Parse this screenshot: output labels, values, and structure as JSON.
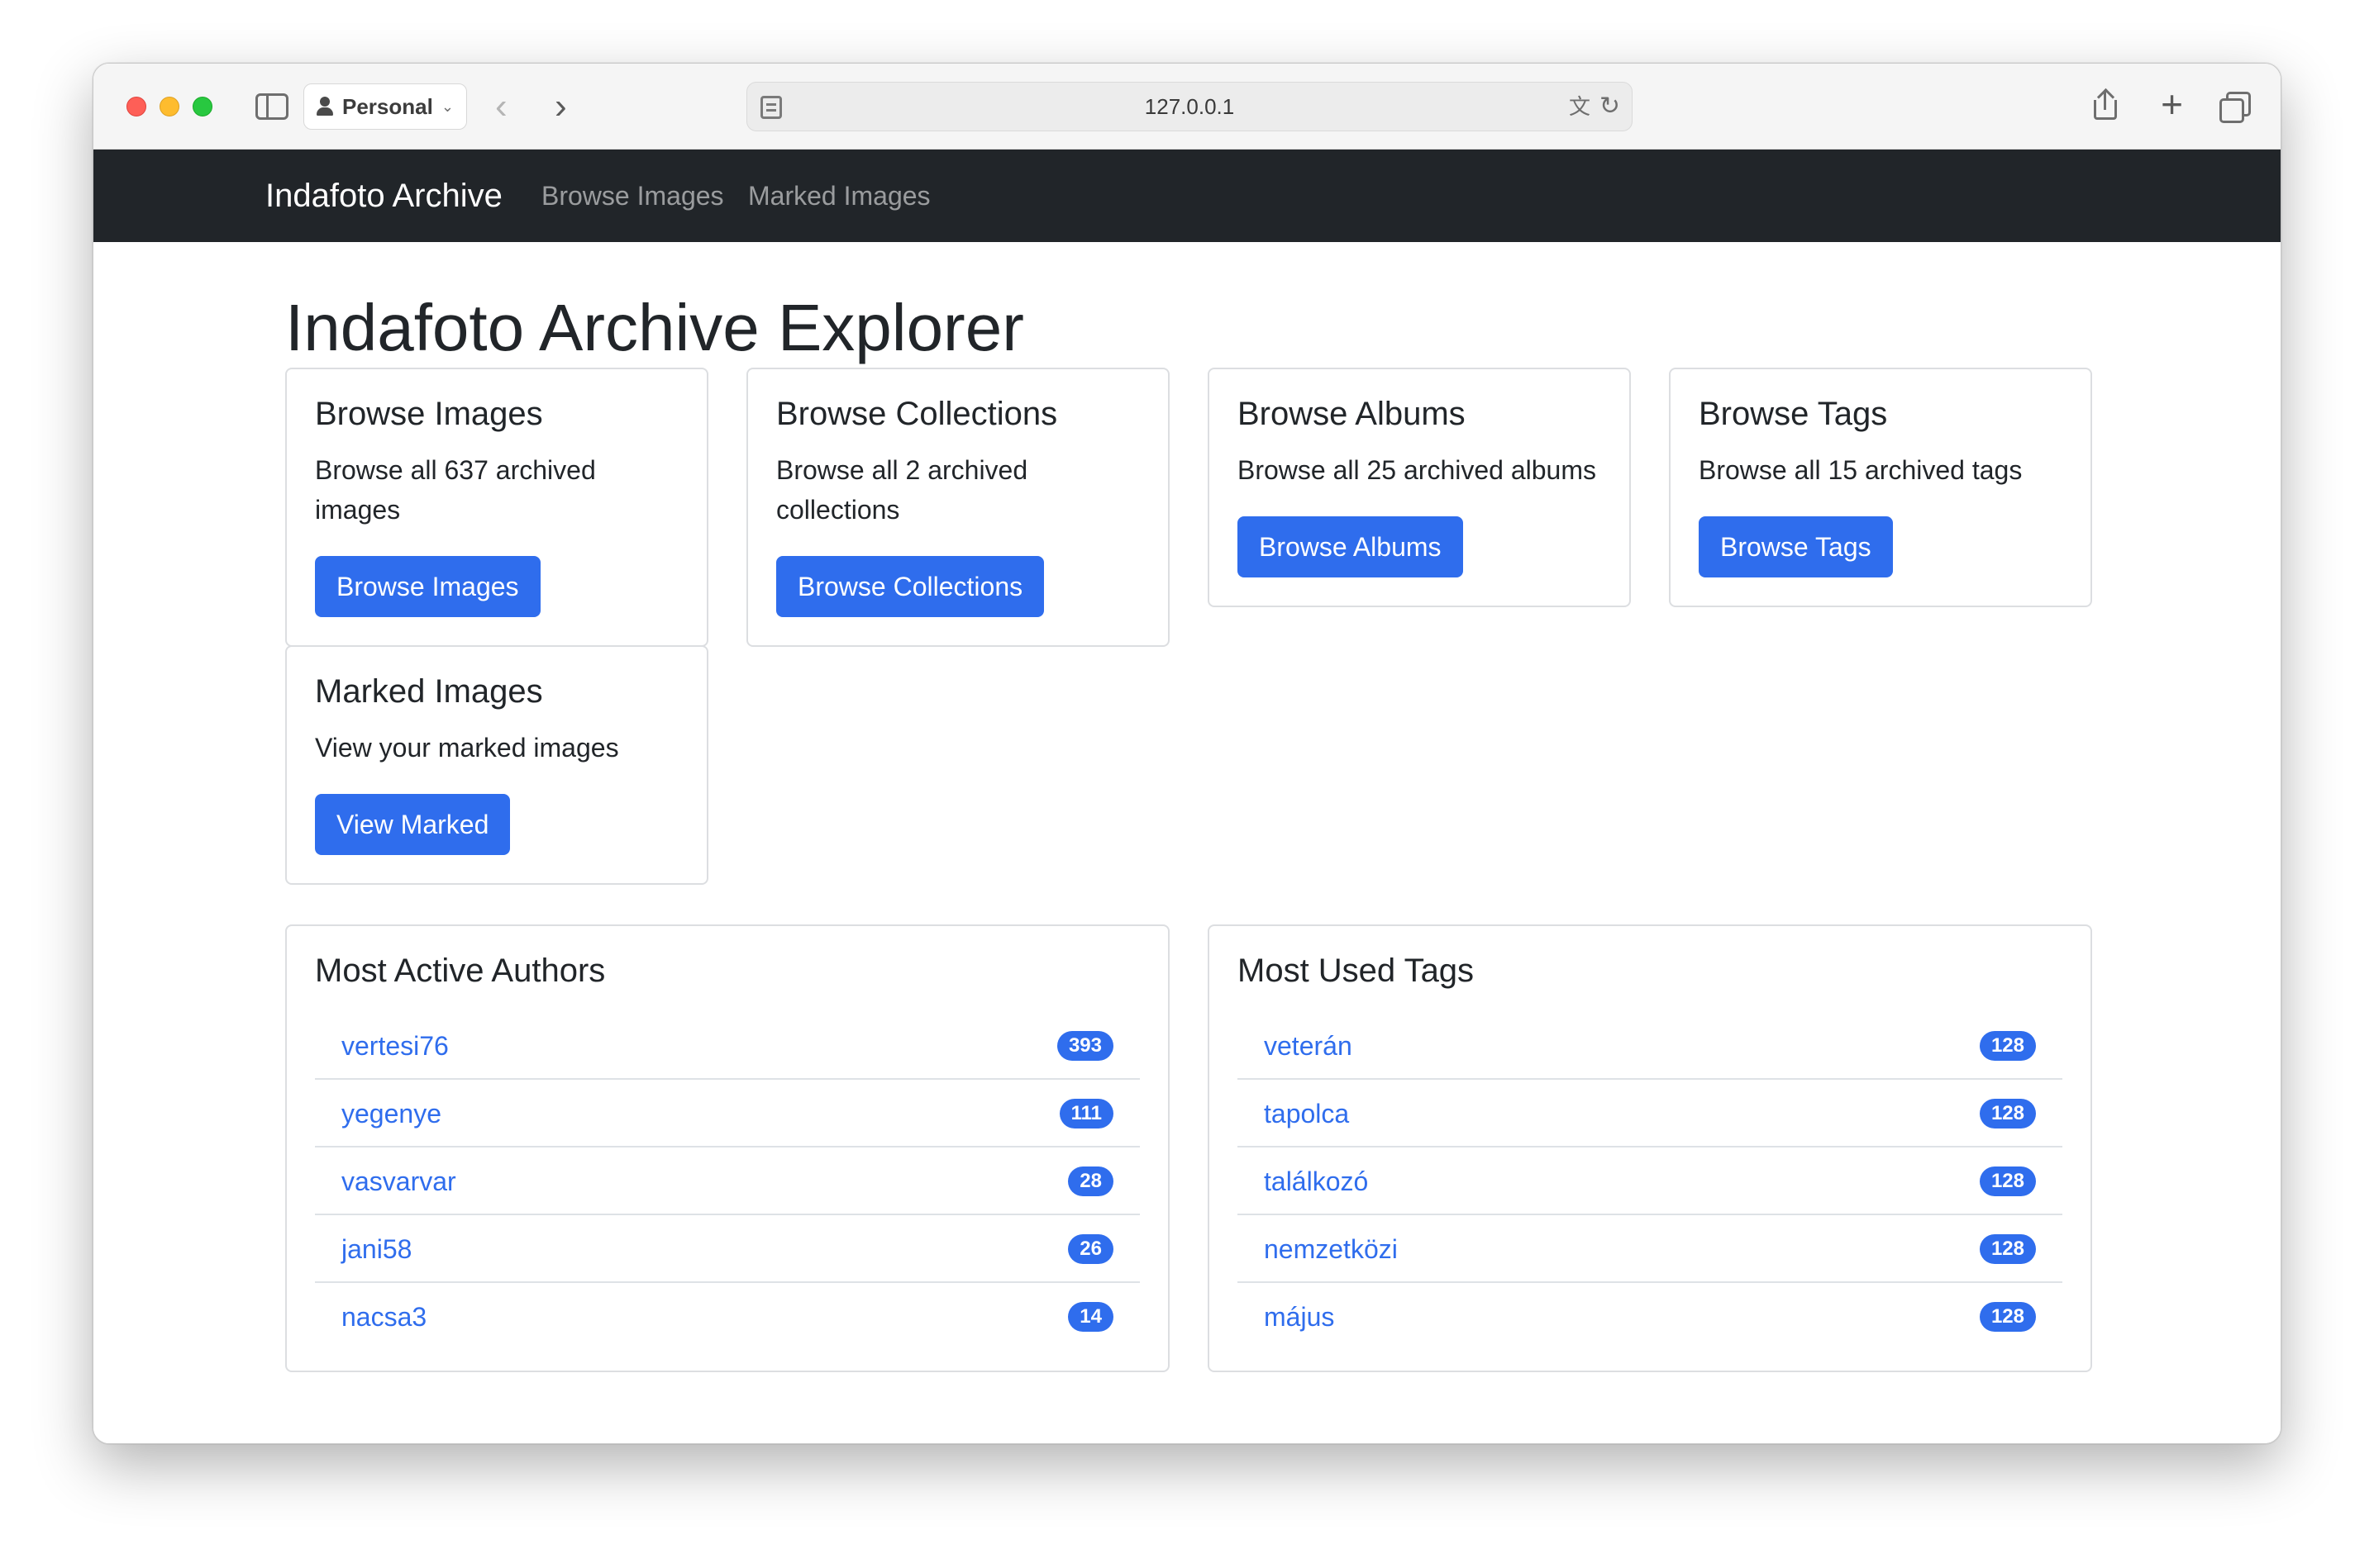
{
  "browser": {
    "profile_label": "Personal",
    "url": "127.0.0.1"
  },
  "navbar": {
    "brand": "Indafoto Archive",
    "links": [
      {
        "label": "Browse Images"
      },
      {
        "label": "Marked Images"
      }
    ]
  },
  "page": {
    "title": "Indafoto Archive Explorer"
  },
  "cards": [
    {
      "title": "Browse Images",
      "text_line1": "Browse all 637 archived",
      "text_line2": "images",
      "button": "Browse Images"
    },
    {
      "title": "Browse Collections",
      "text_line1": "Browse all 2 archived",
      "text_line2": "collections",
      "button": "Browse Collections"
    },
    {
      "title": "Browse Albums",
      "text": "Browse all 25 archived albums",
      "button": "Browse Albums"
    },
    {
      "title": "Browse Tags",
      "text": "Browse all 15 archived tags",
      "button": "Browse Tags"
    },
    {
      "title": "Marked Images",
      "text": "View your marked images",
      "button": "View Marked"
    }
  ],
  "authors": {
    "title": "Most Active Authors",
    "items": [
      {
        "name": "vertesi76",
        "count": "393"
      },
      {
        "name": "yegenye",
        "count": "111"
      },
      {
        "name": "vasvarvar",
        "count": "28"
      },
      {
        "name": "jani58",
        "count": "26"
      },
      {
        "name": "nacsa3",
        "count": "14"
      }
    ]
  },
  "tags": {
    "title": "Most Used Tags",
    "items": [
      {
        "name": "veterán",
        "count": "128"
      },
      {
        "name": "tapolca",
        "count": "128"
      },
      {
        "name": "találkozó",
        "count": "128"
      },
      {
        "name": "nemzetközi",
        "count": "128"
      },
      {
        "name": "május",
        "count": "128"
      }
    ]
  },
  "colors": {
    "primary": "#2f6ded",
    "navbar_bg": "#212529"
  }
}
